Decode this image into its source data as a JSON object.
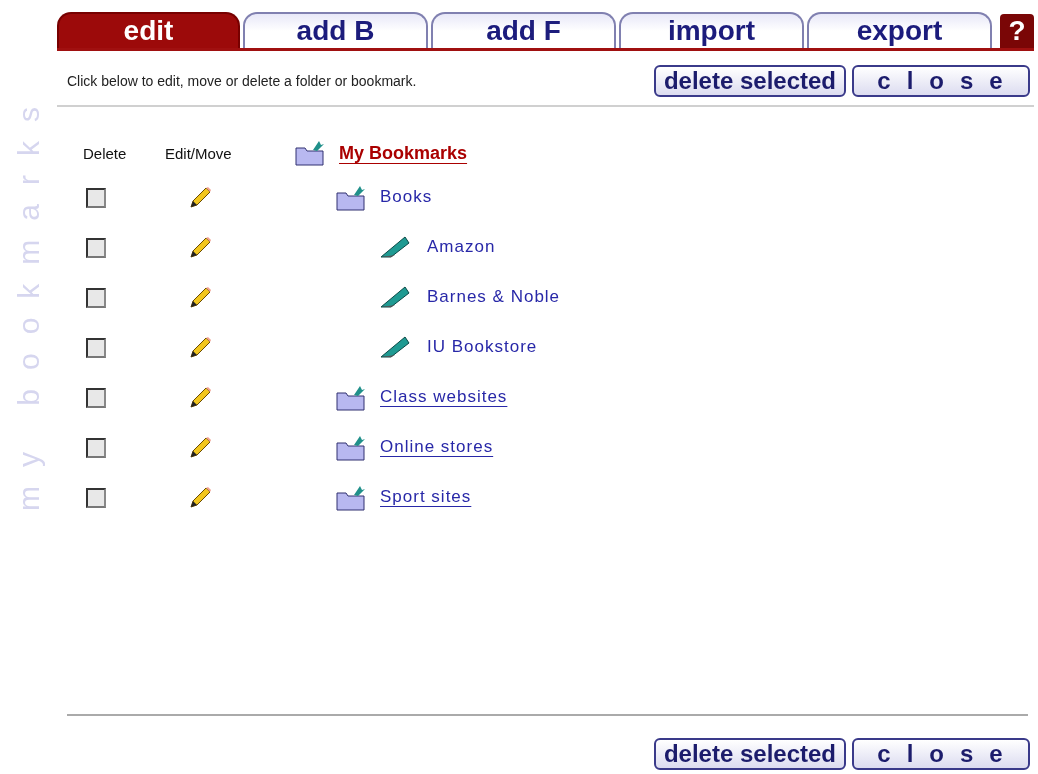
{
  "tabs": [
    {
      "label": "edit",
      "selected": true
    },
    {
      "label": "add B",
      "selected": false
    },
    {
      "label": "add F",
      "selected": false
    },
    {
      "label": "import",
      "selected": false
    },
    {
      "label": "export",
      "selected": false
    }
  ],
  "help": "?",
  "side_title": "my bookmarks",
  "instruction": "Click below to edit, move or delete a folder or bookmark.",
  "buttons_top": [
    "delete selected",
    "close"
  ],
  "columns": [
    "Delete",
    "Edit/Move"
  ],
  "tree": {
    "label": "My Bookmarks",
    "kind": "folder",
    "underlined": true,
    "children": [
      {
        "label": "Books",
        "kind": "folder",
        "underlined": false,
        "checked": false,
        "children": [
          {
            "label": "Amazon",
            "kind": "bookmark",
            "underlined": false,
            "checked": false
          },
          {
            "label": "Barnes & Noble",
            "kind": "bookmark",
            "underlined": false,
            "checked": false
          },
          {
            "label": "IU Bookstore",
            "kind": "bookmark",
            "underlined": false,
            "checked": false
          }
        ]
      },
      {
        "label": "Class websites",
        "kind": "folder",
        "underlined": true,
        "checked": false
      },
      {
        "label": "Online stores",
        "kind": "folder",
        "underlined": true,
        "checked": false
      },
      {
        "label": "Sport sites",
        "kind": "folder",
        "underlined": true,
        "checked": false
      }
    ]
  },
  "buttons_bottom": [
    "delete selected",
    "close"
  ]
}
